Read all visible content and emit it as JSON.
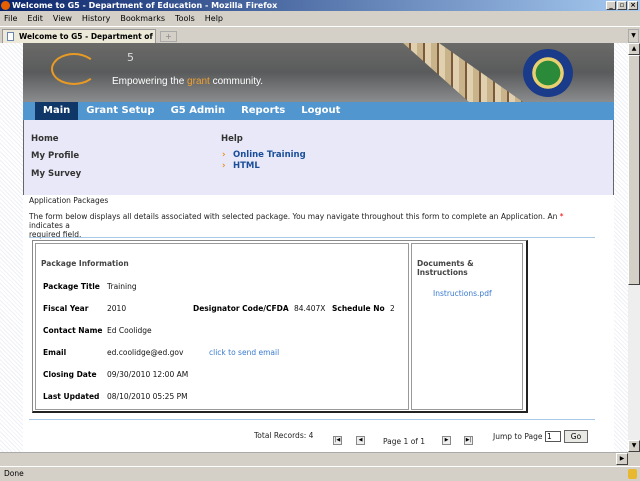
{
  "window": {
    "title": "Welcome to G5 - Department of Education - Mozilla Firefox"
  },
  "menu": [
    "File",
    "Edit",
    "View",
    "History",
    "Bookmarks",
    "Tools",
    "Help"
  ],
  "tab": {
    "label": "Welcome to G5 - Department of Edu...",
    "new_tab": "+"
  },
  "banner": {
    "logo_sup": "5",
    "tagline_pre": "Empowering the ",
    "tagline_hl": "grant",
    "tagline_post": " community."
  },
  "nav": [
    "Main",
    "Grant Setup",
    "G5 Admin",
    "Reports",
    "Logout"
  ],
  "submenu": {
    "left": [
      "Home",
      "My Profile",
      "My Survey"
    ],
    "help_title": "Help",
    "help_links": [
      "Online Training",
      "HTML"
    ]
  },
  "section": {
    "title": "Application Packages",
    "desc": "The form below displays all details associated with selected package. You may navigate throughout this form to complete an Application. An",
    "required_mark": "*",
    "desc2": "indicates a",
    "desc3": "required field."
  },
  "package": {
    "header": "Package Information",
    "title_label": "Package Title",
    "title": "Training",
    "fy_label": "Fiscal Year",
    "fy": "2010",
    "cfda_label": "Designator Code/CFDA",
    "cfda": "84.407X",
    "sched_label": "Schedule No",
    "sched": "2",
    "contact_label": "Contact Name",
    "contact": "Ed Coolidge",
    "email_label": "Email",
    "email": "ed.coolidge@ed.gov",
    "email_link": "click to send email",
    "closing_label": "Closing Date",
    "closing": "09/30/2010 12:00 AM",
    "updated_label": "Last Updated",
    "updated": "08/10/2010 05:25 PM"
  },
  "docs": {
    "header": "Documents & Instructions",
    "files": [
      "Instructions.pdf"
    ]
  },
  "pager": {
    "total": "Total Records: 4",
    "page": "Page 1 of 1",
    "jump_label": "Jump to Page",
    "jump_value": "1",
    "go": "Go"
  },
  "status": {
    "text": "Done"
  },
  "colors": {
    "nav": "#5296d0",
    "nav_active": "#0f3868",
    "submenu_bg": "#e8e8f8",
    "accent": "#e89a24",
    "link": "#3a7ad0"
  }
}
